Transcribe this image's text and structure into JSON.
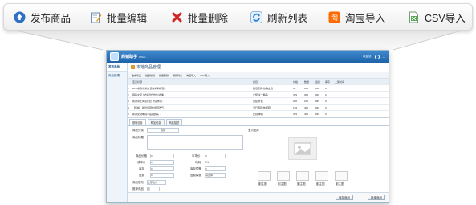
{
  "toolbar": {
    "items": [
      {
        "label": "发布商品",
        "icon": "upload-arrow-icon"
      },
      {
        "label": "批量编辑",
        "icon": "edit-pencil-icon"
      },
      {
        "label": "批量删除",
        "icon": "red-x-icon"
      },
      {
        "label": "刷新列表",
        "icon": "refresh-icon"
      },
      {
        "label": "淘宝导入",
        "icon": "taobao-icon"
      },
      {
        "label": "CSV导入",
        "icon": "csv-file-icon"
      }
    ]
  },
  "app": {
    "name": "商铺助手",
    "subtitle": "www...",
    "user_text": "欢迎您",
    "sidebar": [
      "发布商品",
      "商品管理"
    ],
    "page_title": "本地商品管理",
    "mini_toolbar": [
      "发布商品",
      "批量编辑",
      "批量删除",
      "刷新列表",
      "淘宝导入",
      "CSV导入"
    ],
    "grid_header": [
      "",
      "宝贝标题",
      "类目",
      "价格",
      "数量",
      "运费",
      "库存",
      "上架时间"
    ],
    "grid_rows": [
      [
        "1",
        "2013新款时尚女包单肩斜挎包...",
        "箱包皮具/热销女包",
        "99",
        "100",
        "100",
        "0"
      ],
      [
        "2",
        "韩版女装上衣新款雪纺衫春季...",
        "女装/女士精品",
        "399",
        "300",
        "999",
        "0"
      ],
      [
        "3",
        "新款男士夹克外套 修身休闲...",
        "男装/外套",
        "200",
        "100",
        "999",
        "0"
      ],
      [
        "4",
        "【包邮】新款男鞋休闲鞋透气...",
        "流行男鞋/休闲鞋",
        "199",
        "400",
        "999",
        "0"
      ],
      [
        "5",
        "新款女鞋单鞋平底鞋圆头 ...",
        "女鞋/单鞋",
        "399",
        "400",
        "999",
        "0"
      ]
    ],
    "tabs": [
      "基础信息",
      "附加信息",
      "商品描述"
    ],
    "form_labels": {
      "category": "商品分类",
      "category_btn": "选择",
      "title": "商品标题",
      "image": "宝贝图片",
      "price": "商品价格",
      "cost": "成本价",
      "stock": "库存",
      "weight": "运费",
      "market_price": "市场价",
      "profit": "利润",
      "warn_stock": "库存预警",
      "freight": "运费模板",
      "freight_select": "请选择",
      "publish": "商品发布",
      "publish_select": "立即发布",
      "recommend": "推荐商品",
      "recommend_select": "否"
    },
    "price_values": {
      "price": "0",
      "cost": "0",
      "stock": "0",
      "weight": "0",
      "market": "0",
      "profit": "0%",
      "warn": "0"
    },
    "thumb_labels": [
      "副主图",
      "副主图",
      "副主图",
      "副主图",
      "副主图"
    ],
    "footer": {
      "save": "保存商品",
      "new": "新增商品"
    }
  }
}
